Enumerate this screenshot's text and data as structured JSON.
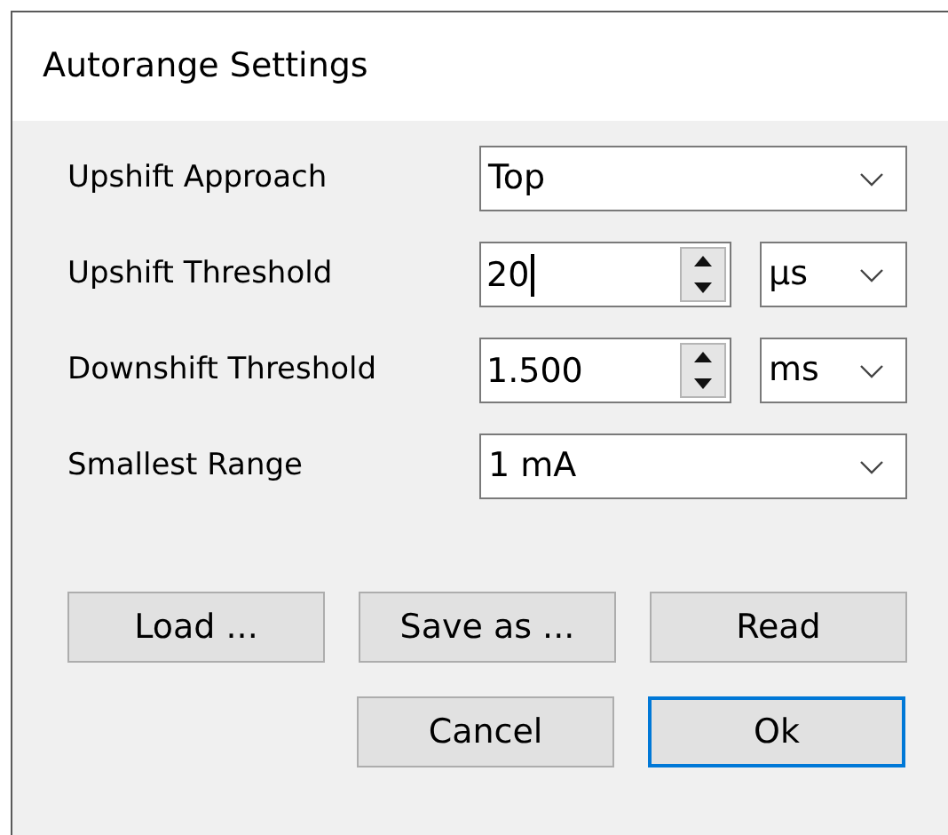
{
  "window": {
    "title": "Autorange Settings"
  },
  "fields": [
    {
      "label": "Upshift Approach",
      "kind": "select",
      "value": "Top"
    },
    {
      "label": "Upshift Threshold",
      "kind": "spin",
      "value": "20",
      "focused": true,
      "unit": "µs"
    },
    {
      "label": "Downshift Threshold",
      "kind": "spin",
      "value": "1.500",
      "focused": false,
      "unit": "ms"
    },
    {
      "label": "Smallest Range",
      "kind": "select",
      "value": "1 mA"
    }
  ],
  "buttons": [
    {
      "label": "Load ...",
      "default": false
    },
    {
      "label": "Save as ...",
      "default": false
    },
    {
      "label": "Read",
      "default": false
    }
  ],
  "dialog_buttons": [
    {
      "label": "Cancel",
      "default": false
    },
    {
      "label": "Ok",
      "default": true
    }
  ]
}
